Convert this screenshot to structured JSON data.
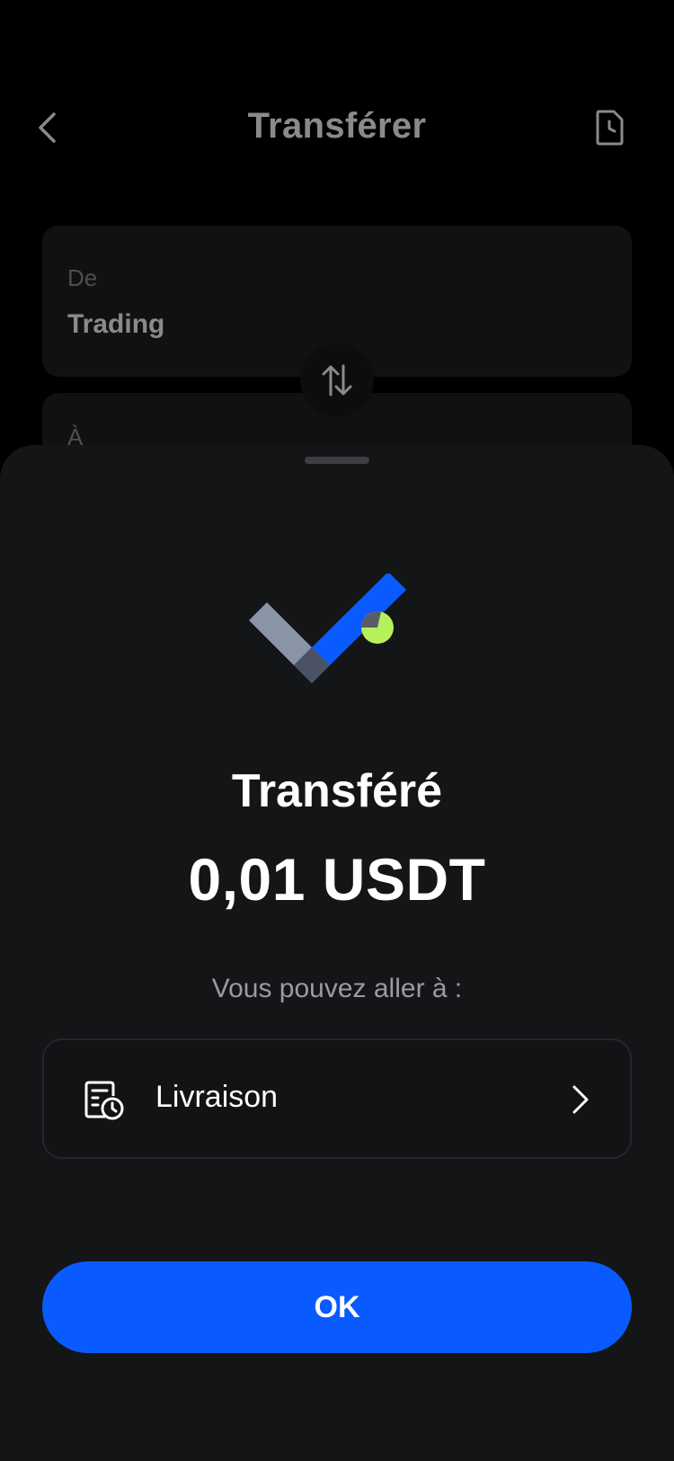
{
  "header": {
    "title": "Transférer",
    "back_icon": "chevron-left-icon",
    "history_icon": "document-clock-icon"
  },
  "transfer_form": {
    "from_label": "De",
    "from_value": "Trading",
    "to_label": "À",
    "swap_icon": "swap-vertical-icon"
  },
  "sheet": {
    "status_title": "Transféré",
    "amount": "0,01 USDT",
    "hint": "Vous pouvez aller à :",
    "destination": {
      "label": "Livraison",
      "icon": "delivery-document-clock-icon"
    },
    "ok_label": "OK"
  },
  "colors": {
    "accent_blue": "#0A5BFF",
    "success_green": "#B6F15C",
    "sheet_bg": "#141517"
  }
}
